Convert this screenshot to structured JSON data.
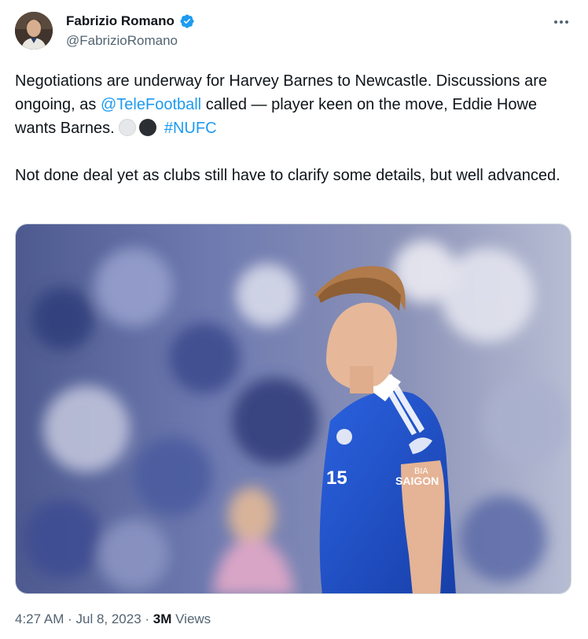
{
  "author": {
    "name": "Fabrizio Romano",
    "handle": "@FabrizioRomano",
    "verified_icon": "verified-badge-icon"
  },
  "tweet": {
    "text_part1": "Negotiations are underway for Harvey Barnes to Newcastle. Discussions are ongoing, as ",
    "mention": "@TeleFootball",
    "text_part2": " called — player keen on the move, Eddie Howe wants Barnes. ",
    "emoji_1": "white-circle",
    "emoji_2": "black-circle",
    "hashtag": "#NUFC",
    "paragraph2": "Not done deal yet as clubs still have to clarify some details, but well advanced."
  },
  "media": {
    "shirt_sponsor_line1": "BIA",
    "shirt_sponsor_line2": "SAIGON",
    "shirt_number": "15"
  },
  "meta": {
    "time": "4:27 AM",
    "sep1": " · ",
    "date": "Jul 8, 2023",
    "sep2": " · ",
    "views_count": "3M",
    "views_label": " Views"
  },
  "colors": {
    "link": "#1d9bf0",
    "secondary_text": "#536471",
    "verified": "#1d9bf0",
    "kit_blue": "#1f4fc6"
  }
}
